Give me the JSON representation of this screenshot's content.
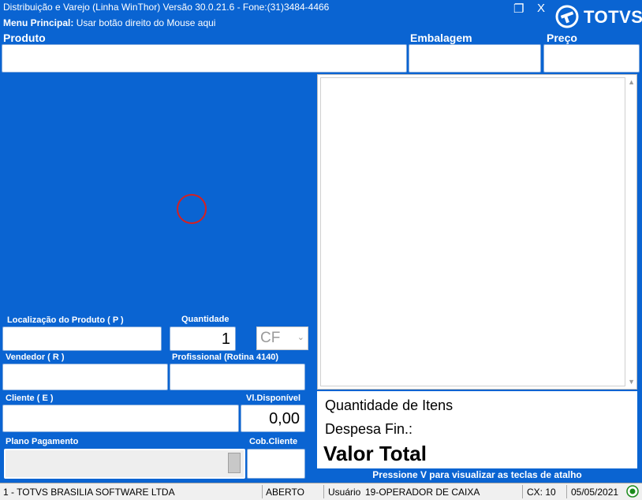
{
  "window": {
    "title": "Distribuição e Varejo (Linha WinThor) Versão 30.0.21.6 - Fone:(31)3484-4466",
    "menu_label": "Menu Principal:",
    "menu_hint": "Usar botão direito do Mouse aqui",
    "restore_glyph": "❐",
    "close_glyph": "X",
    "brand": "TOTVS"
  },
  "header": {
    "produto": "Produto",
    "embalagem": "Embalagem",
    "preco": "Preço"
  },
  "form": {
    "localizacao_label": "Localização do Produto ( P )",
    "quantidade_label": "Quantidade",
    "quantidade_value": "1",
    "cf_value": "CF",
    "cf_caret": "⌄",
    "vendedor_label": "Vendedor ( R )",
    "profissional_label": "Profissional (Rotina 4140)",
    "cliente_label": "Cliente ( E )",
    "vl_disponivel_label": "Vl.Disponível",
    "vl_disponivel_value": "0,00",
    "plano_label": "Plano Pagamento",
    "cob_cliente_label": "Cob.Cliente"
  },
  "totals": {
    "quantidade_itens": "Quantidade de Itens",
    "despesa_fin": "Despesa Fin.:",
    "valor_total": "Valor Total"
  },
  "shortcut_hint": "Pressione V para visualizar as teclas de atalho",
  "statusbar": {
    "company": "1 - TOTVS BRASILIA SOFTWARE LTDA",
    "status": "ABERTO",
    "user_label": "Usuário",
    "user": "19-OPERADOR DE CAIXA",
    "caixa": "CX: 10",
    "date": "05/05/2021"
  },
  "colors": {
    "background": "#0a64d2",
    "field": "#ffffff",
    "statusbar": "#f0f0f0"
  }
}
